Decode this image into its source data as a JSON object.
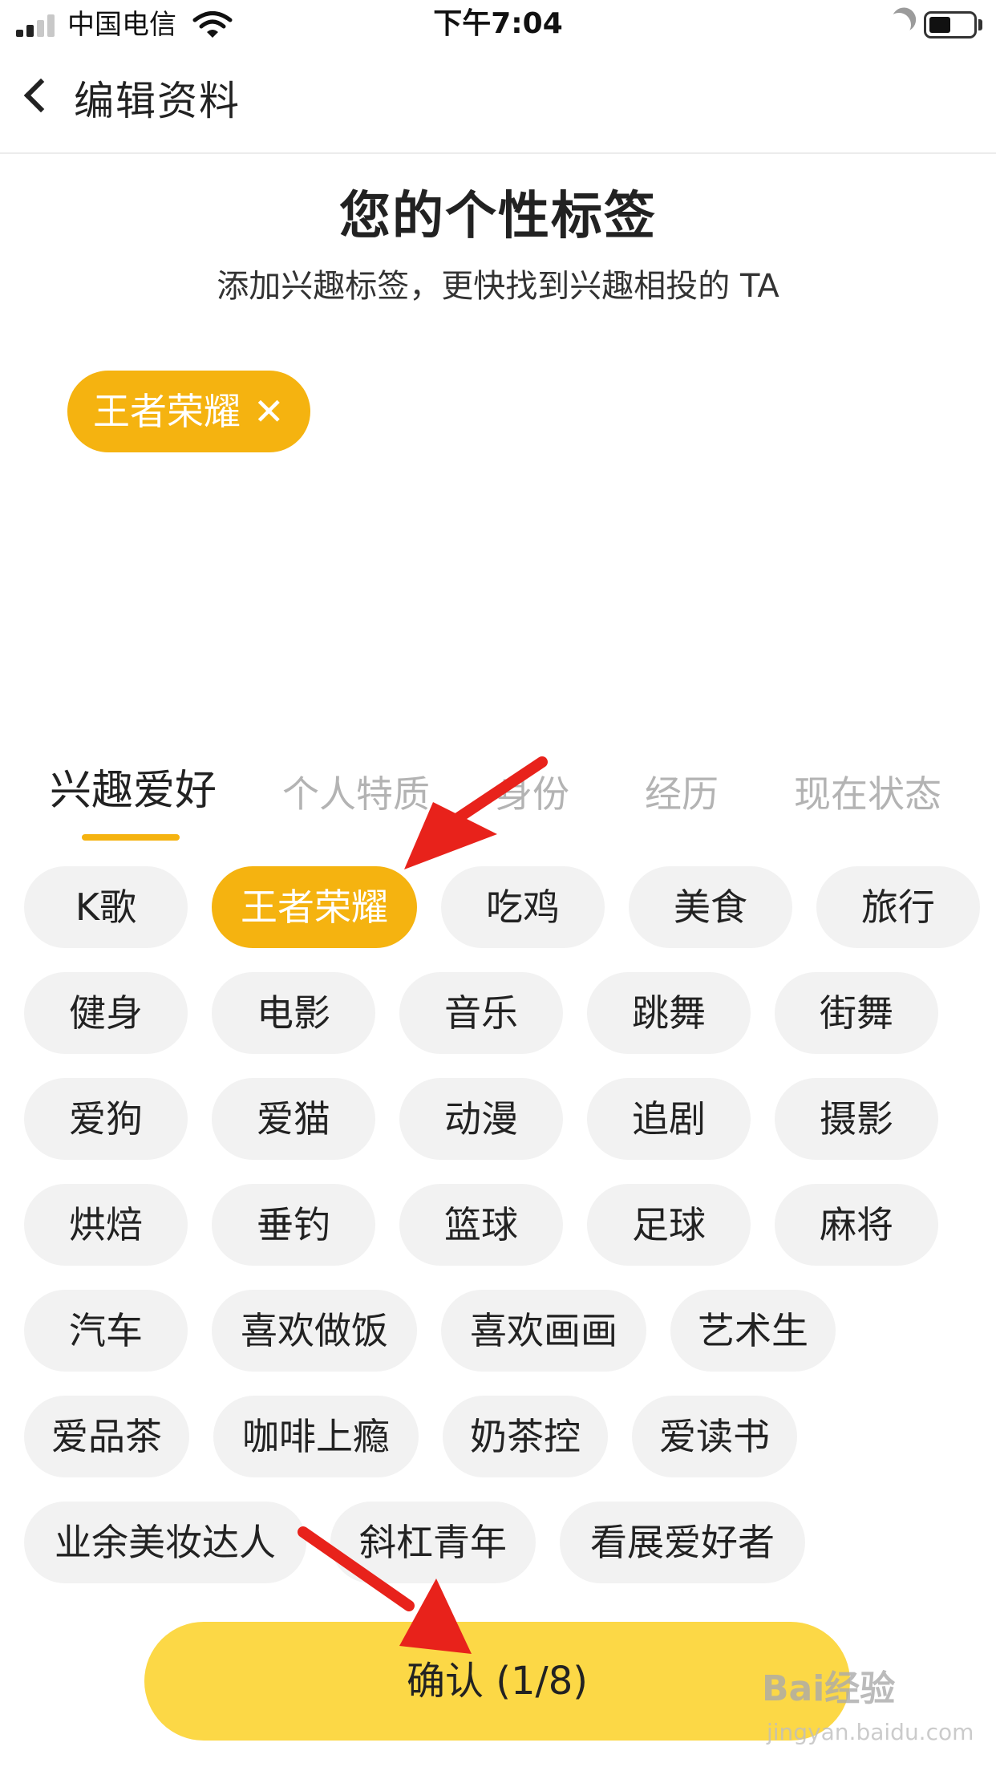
{
  "status_bar": {
    "carrier": "中国电信",
    "time": "下午7:04"
  },
  "nav": {
    "title": "编辑资料"
  },
  "header": {
    "title": "您的个性标签",
    "subtitle": "添加兴趣标签，更快找到兴趣相投的 TA"
  },
  "selected_tags": [
    {
      "label": "王者荣耀",
      "remove": "✕"
    }
  ],
  "tabs": [
    {
      "label": "兴趣爱好",
      "active": true
    },
    {
      "label": "个人特质",
      "active": false
    },
    {
      "label": "身份",
      "active": false
    },
    {
      "label": "经历",
      "active": false
    },
    {
      "label": "现在状态",
      "active": false
    }
  ],
  "tags": [
    {
      "label": "K歌",
      "selected": false
    },
    {
      "label": "王者荣耀",
      "selected": true
    },
    {
      "label": "吃鸡",
      "selected": false
    },
    {
      "label": "美食",
      "selected": false
    },
    {
      "label": "旅行",
      "selected": false
    },
    {
      "label": "健身",
      "selected": false
    },
    {
      "label": "电影",
      "selected": false
    },
    {
      "label": "音乐",
      "selected": false
    },
    {
      "label": "跳舞",
      "selected": false
    },
    {
      "label": "街舞",
      "selected": false
    },
    {
      "label": "爱狗",
      "selected": false
    },
    {
      "label": "爱猫",
      "selected": false
    },
    {
      "label": "动漫",
      "selected": false
    },
    {
      "label": "追剧",
      "selected": false
    },
    {
      "label": "摄影",
      "selected": false
    },
    {
      "label": "烘焙",
      "selected": false
    },
    {
      "label": "垂钓",
      "selected": false
    },
    {
      "label": "篮球",
      "selected": false
    },
    {
      "label": "足球",
      "selected": false
    },
    {
      "label": "麻将",
      "selected": false
    },
    {
      "label": "汽车",
      "selected": false
    },
    {
      "label": "喜欢做饭",
      "selected": false
    },
    {
      "label": "喜欢画画",
      "selected": false
    },
    {
      "label": "艺术生",
      "selected": false
    },
    {
      "label": "爱品茶",
      "selected": false
    },
    {
      "label": "咖啡上瘾",
      "selected": false
    },
    {
      "label": "奶茶控",
      "selected": false
    },
    {
      "label": "爱读书",
      "selected": false
    },
    {
      "label": "业余美妆达人",
      "selected": false
    },
    {
      "label": "斜杠青年",
      "selected": false
    },
    {
      "label": "看展爱好者",
      "selected": false
    }
  ],
  "confirm": {
    "label": "确认 (1/8)"
  },
  "watermark": {
    "brand": "Bai经验",
    "url": "jingyan.baidu.com"
  },
  "colors": {
    "accent": "#f5b310",
    "confirm": "#fcd846",
    "chip_bg": "#f2f2f2",
    "arrow": "#e8221b"
  }
}
